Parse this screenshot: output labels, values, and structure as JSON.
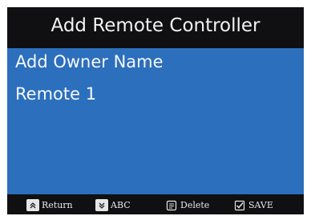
{
  "header": {
    "title": "Add Remote Controller"
  },
  "list": {
    "items": [
      {
        "label": "Add Owner Name"
      },
      {
        "label": "Remote 1"
      }
    ]
  },
  "footer": {
    "return_label": "Return",
    "abc_label": "ABC",
    "delete_label": "Delete",
    "save_label": "SAVE"
  },
  "icons": {
    "return": "double-chevron-up-icon",
    "abc": "double-chevron-down-icon",
    "delete": "document-icon",
    "save": "checkbox-icon"
  },
  "colors": {
    "screen_background": "#101012",
    "panel_blue": "#2c6fbd",
    "text_light": "#f2f2f2"
  }
}
